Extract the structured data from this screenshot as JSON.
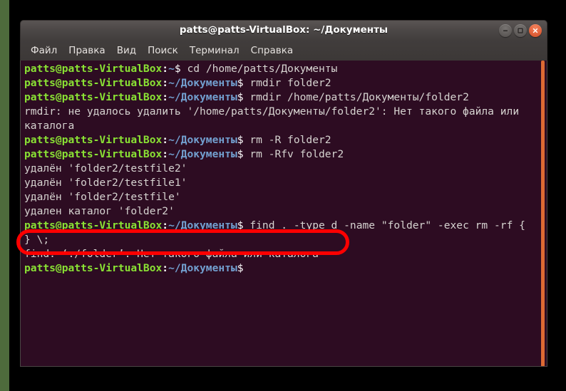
{
  "window": {
    "title": "patts@patts-VirtualBox: ~/Документы",
    "controls": [
      {
        "name": "minimize",
        "glyph": "minimize-icon"
      },
      {
        "name": "maximize",
        "glyph": "maximize-icon"
      },
      {
        "name": "close",
        "glyph": "close-icon"
      }
    ]
  },
  "menubar": {
    "items": [
      {
        "label": "Файл"
      },
      {
        "label": "Правка"
      },
      {
        "label": "Вид"
      },
      {
        "label": "Поиск"
      },
      {
        "label": "Терминал"
      },
      {
        "label": "Справка"
      }
    ]
  },
  "terminal": {
    "user_host": "patts@patts-VirtualBox",
    "colon": ":",
    "prompt_symbol": "$",
    "paths": {
      "home": "~",
      "documents": "~/Документы"
    },
    "lines": [
      {
        "type": "prompt",
        "path": "~",
        "command": " cd /home/patts/Документы"
      },
      {
        "type": "prompt",
        "path": "~/Документы",
        "command": " rmdir folder2"
      },
      {
        "type": "prompt",
        "path": "~/Документы",
        "command": " rmdir /home/patts/Документы/folder2"
      },
      {
        "type": "output",
        "text": "rmdir: не удалось удалить '/home/patts/Документы/folder2': Нет такого файла или"
      },
      {
        "type": "output",
        "text": "каталога"
      },
      {
        "type": "prompt",
        "path": "~/Документы",
        "command": " rm -R folder2"
      },
      {
        "type": "prompt",
        "path": "~/Документы",
        "command": " rm -Rfv folder2"
      },
      {
        "type": "output",
        "text": "удалён 'folder2/testfile2'"
      },
      {
        "type": "output",
        "text": "удалён 'folder2/testfile1'"
      },
      {
        "type": "output",
        "text": "удалён 'folder2/testfile'"
      },
      {
        "type": "output",
        "text": "удален каталог 'folder2'"
      },
      {
        "type": "prompt",
        "path": "~/Документы",
        "command": " find . -type d -name \"folder\" -exec rm -rf {"
      },
      {
        "type": "output",
        "text": "} \\;"
      },
      {
        "type": "output",
        "text": "find: ‘./folder’: Нет такого файла или каталога"
      },
      {
        "type": "prompt",
        "path": "~/Документы",
        "command": ""
      }
    ]
  },
  "annotation": {
    "highlight_color": "#ff0000",
    "shape": "rounded-rectangle"
  },
  "colors": {
    "terminal_background": "#2d0c22",
    "prompt_user": "#8ae234",
    "prompt_path": "#729fcf",
    "output_text": "#d6d3d0",
    "titlebar": "#413d3c",
    "scrollbar": "#dd6a33",
    "desktop": "#000000"
  }
}
